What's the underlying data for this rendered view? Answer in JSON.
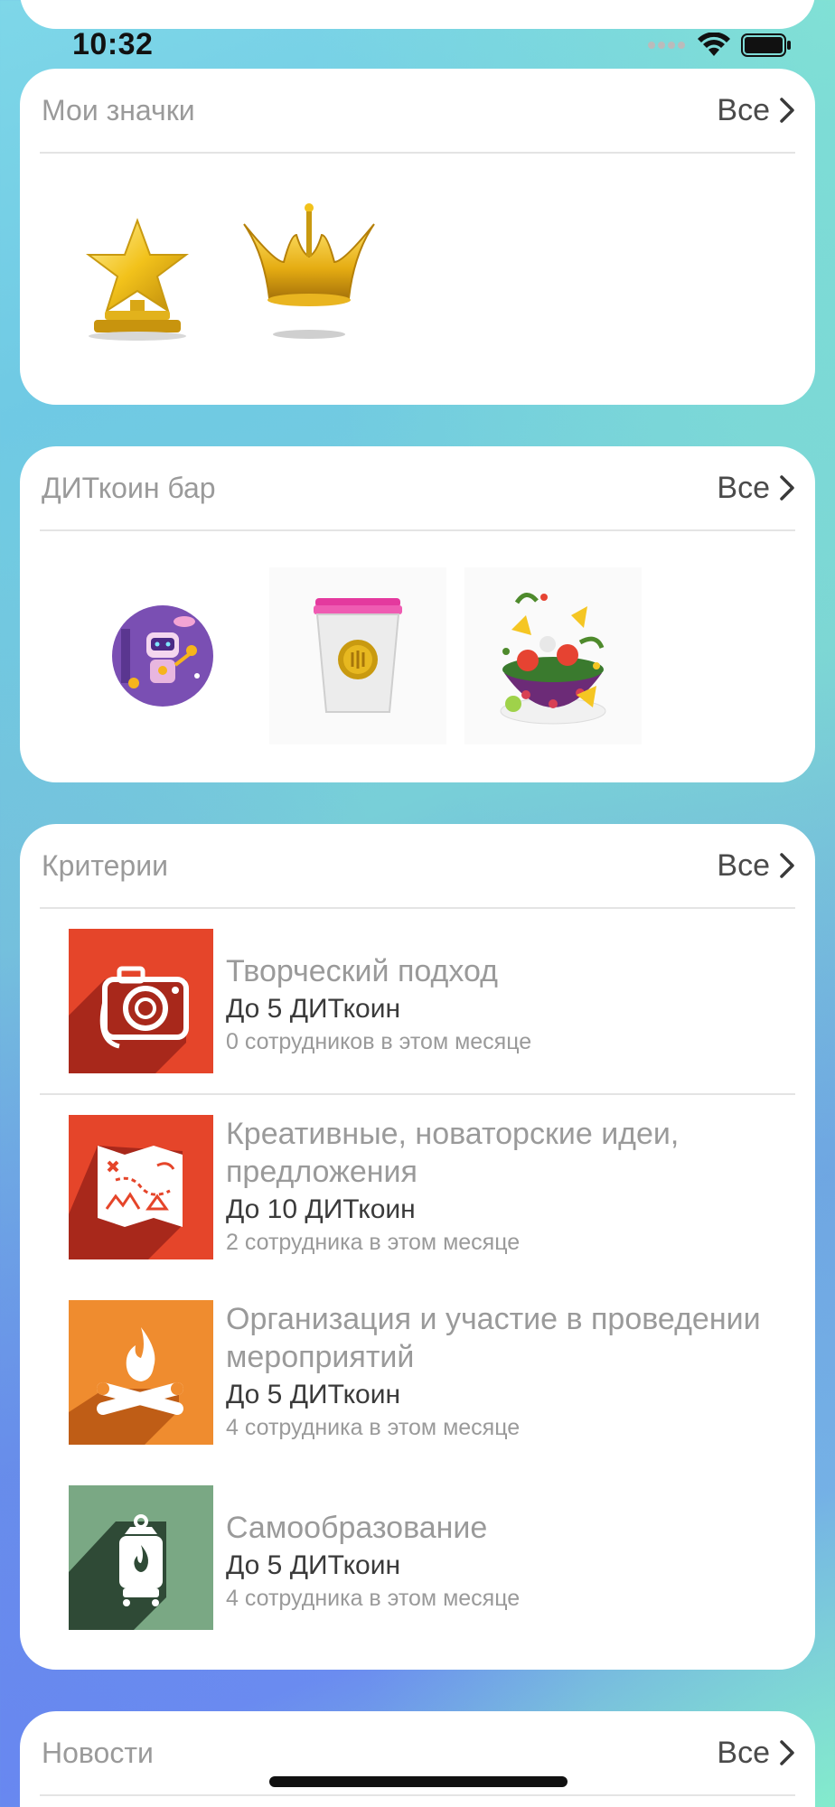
{
  "status": {
    "time": "10:32"
  },
  "badges": {
    "title": "Мои значки",
    "all_label": "Все",
    "items": [
      "star-trophy-icon",
      "gold-crown-icon"
    ]
  },
  "bar": {
    "title": "ДИТкоин бар",
    "all_label": "Все",
    "items": [
      "robot-party-icon",
      "coffee-cup-icon",
      "salad-bowl-icon"
    ]
  },
  "criteria": {
    "title": "Критерии",
    "all_label": "Все",
    "items": [
      {
        "name": "Творческий подход",
        "coins": "До 5 ДИТкоин",
        "count": "0 сотрудников в этом месяце",
        "color": "#e5452a",
        "icon": "camera-icon"
      },
      {
        "name": "Креативные, новаторские идеи, предложения",
        "coins": "До 10 ДИТкоин",
        "count": "2 сотрудника в этом месяце",
        "color": "#e5452a",
        "icon": "treasure-map-icon"
      },
      {
        "name": "Организация и участие в проведении мероприятий",
        "coins": "До 5 ДИТкоин",
        "count": "4 сотрудника в этом месяце",
        "color": "#ef8c2f",
        "icon": "campfire-icon"
      },
      {
        "name": "Самообразование",
        "coins": "До 5 ДИТкоин",
        "count": "4 сотрудника в этом месяце",
        "color": "#7aa884",
        "icon": "lantern-icon"
      }
    ]
  },
  "news": {
    "title": "Новости",
    "all_label": "Все"
  }
}
